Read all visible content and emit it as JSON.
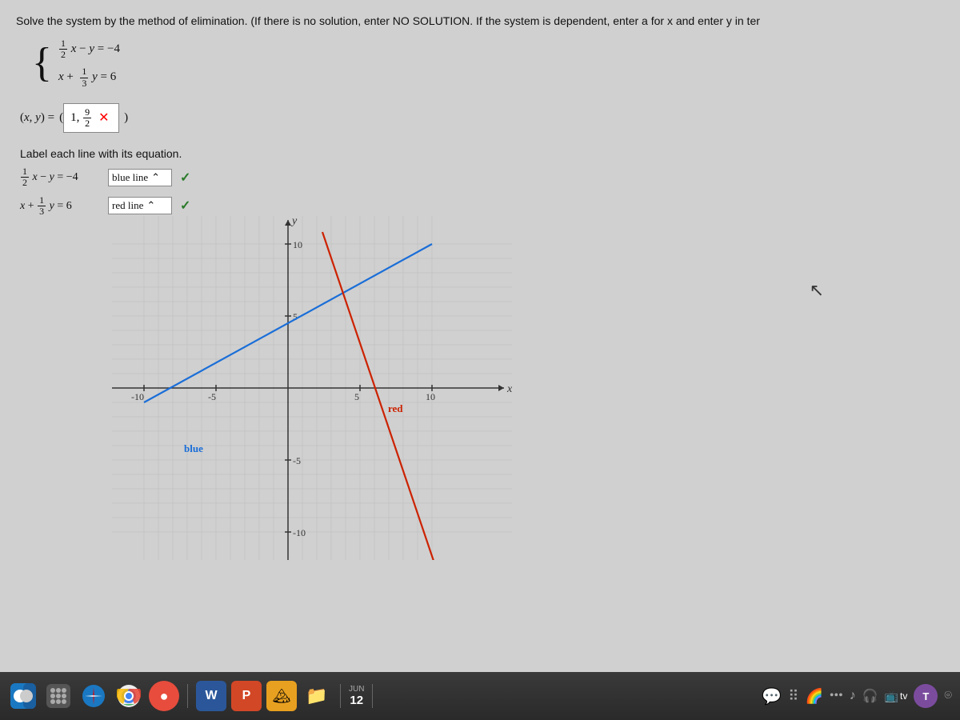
{
  "problem": {
    "instruction": "Solve the system by the method of elimination. (If there is no solution, enter NO SOLUTION. If the system is dependent, enter a for x and enter y in ter",
    "eq1": "½x − y = −4",
    "eq2": "x + ⅓y = 6",
    "answer": {
      "label": "(x, y) =",
      "open_paren": "(",
      "x_value": "1,",
      "y_numerator": "9",
      "y_denominator": "2",
      "close_paren": ")",
      "x_button": "✕"
    }
  },
  "label_section": {
    "title": "Label each line with its equation.",
    "line1": {
      "equation": "½x − y = −4",
      "color_label": "blue line",
      "selected": "blue line"
    },
    "line2": {
      "equation": "x + ⅓y = 6",
      "color_label": "red line",
      "selected": "red line"
    },
    "check": "✓"
  },
  "graph": {
    "y_axis_label": "y",
    "x_axis_label": "x",
    "tick_labels": {
      "x_positive": [
        "5",
        "10"
      ],
      "x_negative": [
        "-5",
        "-10"
      ],
      "y_positive": [
        "5",
        "10"
      ],
      "y_negative": [
        "-5",
        "-10"
      ]
    },
    "blue_line_label": "blue",
    "red_line_label": "red"
  },
  "taskbar": {
    "time": "12",
    "tv_label": "tv",
    "icons": [
      "🔍",
      "🚀",
      "🌐",
      "🔴",
      "W",
      "P",
      "📄",
      "📁"
    ]
  }
}
